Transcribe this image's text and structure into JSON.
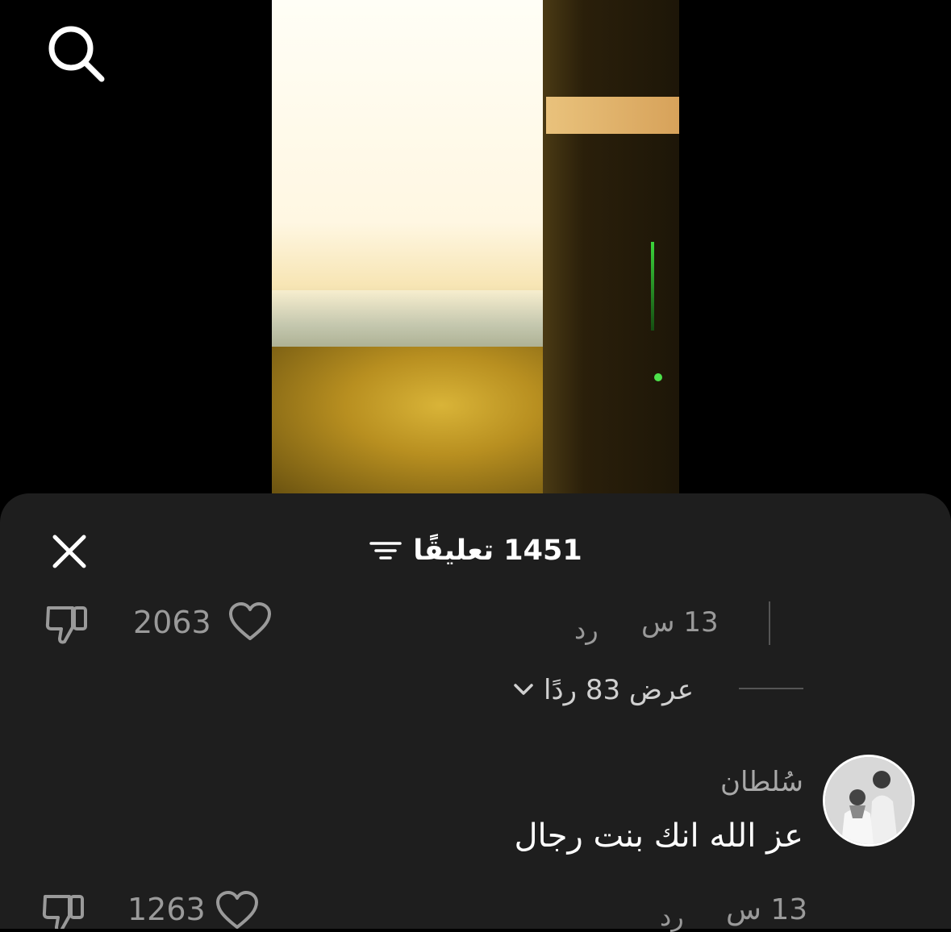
{
  "icons": {
    "search": "search-icon",
    "close": "close-icon",
    "filter": "filter-icon",
    "dislike": "thumbs-down-icon",
    "like": "heart-icon",
    "expand": "chevron-down-icon"
  },
  "sheet": {
    "title": "1451 تعليقًا"
  },
  "comments": [
    {
      "time": "13 س",
      "reply_label": "رد",
      "likes": "2063",
      "view_replies": "عرض 83 ردًا"
    },
    {
      "username": "سُلطان",
      "text": "عز الله انك بنت رجال",
      "time": "13 س",
      "reply_label": "رد",
      "likes": "1263"
    }
  ]
}
